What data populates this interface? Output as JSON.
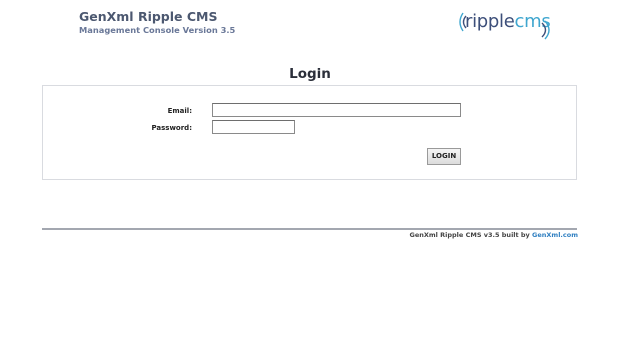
{
  "header": {
    "title_prefix": "Gen",
    "title_bold": "Xml",
    "title_rest": " Ripple CMS",
    "subtitle": "Management Console Version 3.5",
    "logo_part1": "ripple",
    "logo_part2": "cms"
  },
  "login": {
    "title": "Login",
    "email_label": "Email:",
    "email_value": "",
    "password_label": "Password:",
    "password_value": "",
    "button_label": "LOGIN"
  },
  "footer": {
    "text": "GenXml Ripple CMS v3.5 built by ",
    "link_text": "GenXml.com"
  },
  "colors": {
    "brand_text": "#4c5870",
    "logo_dark": "#3d4f7a",
    "logo_light": "#3fa6cf",
    "link": "#2f7fc1"
  }
}
